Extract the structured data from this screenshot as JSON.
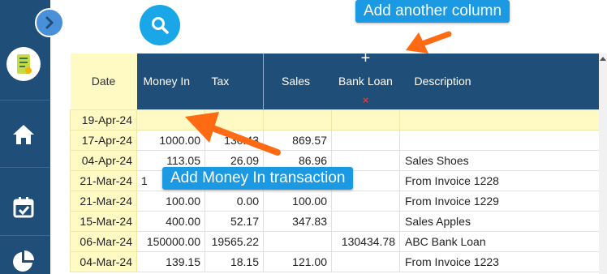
{
  "sidebar": {
    "expand_icon": "chevron-right-icon",
    "avatar_icon": "receipt-logo-icon",
    "items": [
      {
        "name": "home",
        "icon": "home-icon"
      },
      {
        "name": "calendar",
        "icon": "calendar-check-icon"
      },
      {
        "name": "reports",
        "icon": "pie-chart-icon"
      }
    ]
  },
  "search": {
    "icon": "search-icon"
  },
  "table": {
    "headers": {
      "date": "Date",
      "money_in": "Money In",
      "tax": "Tax",
      "sales": "Sales",
      "bank_loan": "Bank Loan",
      "description": "Description",
      "add_column_symbol": "+",
      "delete_column_symbol": "×"
    },
    "rows": [
      {
        "date": "19-Apr-24",
        "money_in": "",
        "tax": "",
        "sales": "",
        "bank_loan": "",
        "description": ""
      },
      {
        "date": "17-Apr-24",
        "money_in": "1000.00",
        "tax": "130.43",
        "sales": "869.57",
        "bank_loan": "",
        "description": ""
      },
      {
        "date": "04-Apr-24",
        "money_in": "113.05",
        "tax": "26.09",
        "sales": "86.96",
        "bank_loan": "",
        "description": "Sales Shoes"
      },
      {
        "date": "21-Mar-24",
        "money_in": "1",
        "tax": "",
        "sales": "",
        "bank_loan": "",
        "description": "From Invoice 1228"
      },
      {
        "date": "21-Mar-24",
        "money_in": "100.00",
        "tax": "0.00",
        "sales": "100.00",
        "bank_loan": "",
        "description": "From Invoice 1229"
      },
      {
        "date": "15-Mar-24",
        "money_in": "400.00",
        "tax": "52.17",
        "sales": "347.83",
        "bank_loan": "",
        "description": "Sales Apples"
      },
      {
        "date": "06-Mar-24",
        "money_in": "150000.00",
        "tax": "19565.22",
        "sales": "",
        "bank_loan": "130434.78",
        "description": "ABC Bank Loan"
      },
      {
        "date": "04-Mar-24",
        "money_in": "139.15",
        "tax": "18.15",
        "sales": "121.00",
        "bank_loan": "",
        "description": "From Invoice 1223"
      }
    ]
  },
  "tooltips": {
    "add_column": "Add another column",
    "add_money_in": "Add Money In transaction"
  },
  "colors": {
    "sidebar": "#1f4e79",
    "header": "#1f4e79",
    "date_column": "#fff9c4",
    "accent_blue": "#1b9ae3",
    "pointer_orange": "#ff6a13",
    "delete_red": "#e53935"
  }
}
